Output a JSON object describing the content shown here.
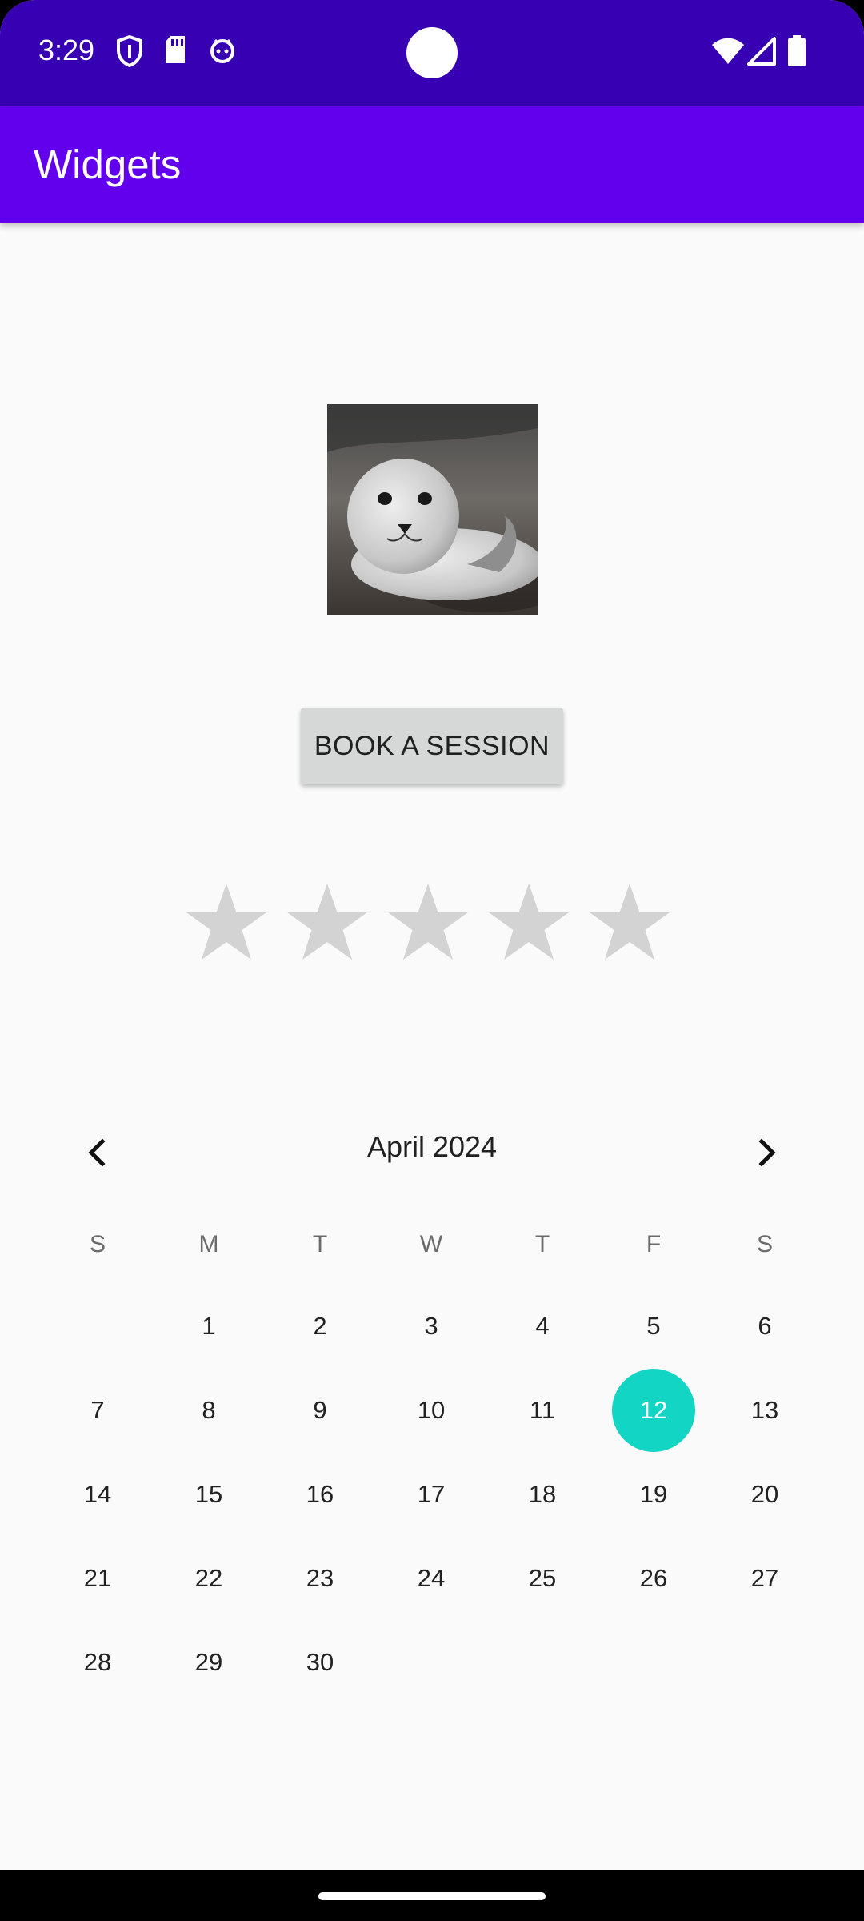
{
  "status_bar": {
    "time": "3:29",
    "left_icons": [
      "shield-icon",
      "sd-card-icon",
      "android-debug-icon"
    ],
    "right_icons": [
      "wifi-icon",
      "cell-signal-icon",
      "battery-icon"
    ],
    "background": "#3700b3"
  },
  "app_bar": {
    "title": "Widgets",
    "background": "#6200ee"
  },
  "image": {
    "subject": "seal-photo"
  },
  "button": {
    "label": "BOOK A SESSION"
  },
  "rating": {
    "max": 5,
    "value": 0,
    "empty_color": "#d3d3d3"
  },
  "calendar": {
    "month_label": "April 2024",
    "weekdays": [
      "S",
      "M",
      "T",
      "W",
      "T",
      "F",
      "S"
    ],
    "first_weekday_offset": 1,
    "days_in_month": 30,
    "selected_day": "12",
    "selected_color": "#12d6c3",
    "days": [
      "1",
      "2",
      "3",
      "4",
      "5",
      "6",
      "7",
      "8",
      "9",
      "10",
      "11",
      "12",
      "13",
      "14",
      "15",
      "16",
      "17",
      "18",
      "19",
      "20",
      "21",
      "22",
      "23",
      "24",
      "25",
      "26",
      "27",
      "28",
      "29",
      "30"
    ]
  }
}
